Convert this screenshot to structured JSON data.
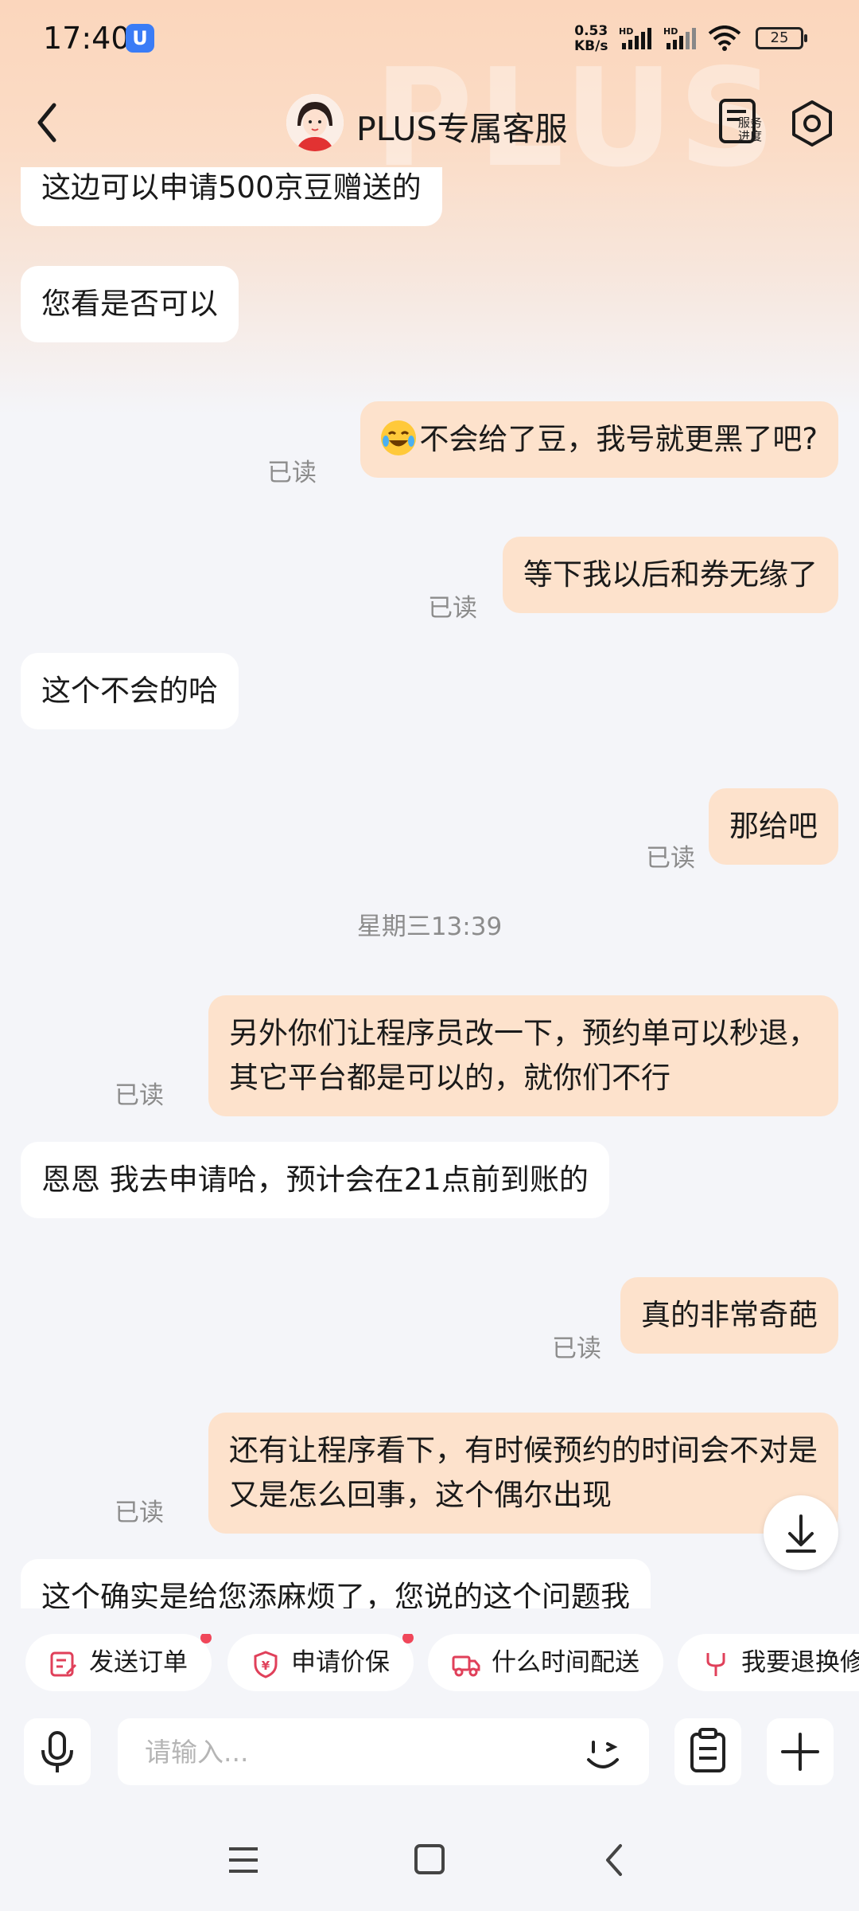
{
  "status_bar": {
    "time": "17:40",
    "speed_value": "0.53",
    "speed_unit": "KB/s",
    "battery": "25"
  },
  "header": {
    "title": "PLUS专属客服",
    "watermark": "PLUS",
    "progress_label_line1": "服务",
    "progress_label_line2": "进度"
  },
  "messages": [
    {
      "side": "left",
      "text": "这边可以申请500京豆赠送的"
    },
    {
      "side": "left",
      "text": "您看是否可以"
    },
    {
      "side": "right",
      "text": "不会给了豆，我号就更黑了吧?",
      "read": "已读",
      "emoji": "crying-laughing-emoji"
    },
    {
      "side": "right",
      "text": "等下我以后和券无缘了",
      "read": "已读"
    },
    {
      "side": "left",
      "text": "这个不会的哈"
    },
    {
      "side": "right",
      "text": "那给吧",
      "read": "已读"
    },
    {
      "side": "time",
      "text": "星期三13:39"
    },
    {
      "side": "right",
      "text_line1": "另外你们让程序员改一下，预约单可以秒退，",
      "text_line2": "其它平台都是可以的，就你们不行",
      "read": "已读"
    },
    {
      "side": "left",
      "text": "恩恩  我去申请哈，预计会在21点前到账的"
    },
    {
      "side": "right",
      "text": "真的非常奇葩",
      "read": "已读"
    },
    {
      "side": "right",
      "text_line1": "还有让程序看下，有时候预约的时间会不对是",
      "text_line2": "又是怎么回事，这个偶尔出现",
      "read": "已读"
    },
    {
      "side": "left",
      "text": "这个确实是给您添麻烦了，您说的这个问题我"
    }
  ],
  "quick_actions": [
    {
      "label": "发送订单",
      "badge": true
    },
    {
      "label": "申请价保",
      "badge": true
    },
    {
      "label": "什么时间配送",
      "badge": false
    },
    {
      "label": "我要退换修",
      "badge": false
    }
  ],
  "input": {
    "placeholder": "请输入..."
  },
  "colors": {
    "accent": "#e0405a",
    "bubble_right": "#fde2cc",
    "bubble_left": "#ffffff",
    "background": "#f4f5f9"
  }
}
